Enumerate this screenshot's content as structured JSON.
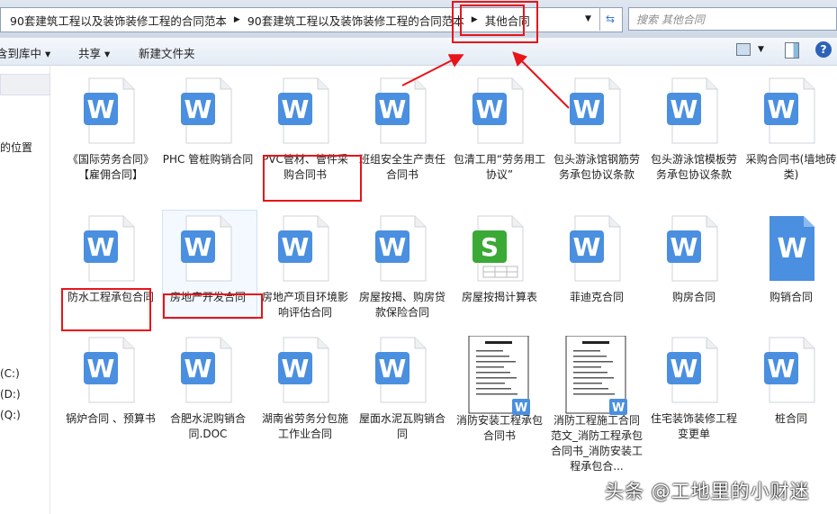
{
  "breadcrumb": [
    "90套建筑工程以及装饰装修工程的合同范本",
    "90套建筑工程以及装饰装修工程的合同范本",
    "其他合同"
  ],
  "search_placeholder": "搜索 其他合同",
  "toolbar": {
    "library": "含到库中 ▾",
    "share": "共享 ▾",
    "new_folder": "新建文件夹"
  },
  "sidebar": {
    "location": "的位置",
    "drives": [
      "(C:)",
      "(D:)",
      "(Q:)"
    ]
  },
  "files": [
    {
      "name": "《国际劳务合同》【雇佣合同】",
      "type": "doc"
    },
    {
      "name": "PHC 管桩购销合同",
      "type": "doc"
    },
    {
      "name": "PVC管材、管件采购合同书",
      "type": "doc"
    },
    {
      "name": "班组安全生产责任合同书",
      "type": "doc"
    },
    {
      "name": "包清工用“劳务用工协议”",
      "type": "doc"
    },
    {
      "name": "包头游泳馆钢筋劳务承包协议条款",
      "type": "doc"
    },
    {
      "name": "包头游泳馆模板劳务承包协议条款",
      "type": "doc"
    },
    {
      "name": "采购合同书(墙地砖类)",
      "type": "doc"
    },
    {
      "name": "防水工程承包合同",
      "type": "doc"
    },
    {
      "name": "房地产开发合同",
      "type": "doc"
    },
    {
      "name": "房地产项目环境影响评估合同",
      "type": "doc"
    },
    {
      "name": "房屋按揭、购房贷款保险合同",
      "type": "doc"
    },
    {
      "name": "房屋按揭计算表",
      "type": "sheet"
    },
    {
      "name": "菲迪克合同",
      "type": "doc"
    },
    {
      "name": "购房合同",
      "type": "doc"
    },
    {
      "name": "购销合同",
      "type": "docsolid"
    },
    {
      "name": "锅炉合同 、预算书",
      "type": "doc"
    },
    {
      "name": "合肥水泥购销合同.DOC",
      "type": "doc"
    },
    {
      "name": "湖南省劳务分包施工作业合同",
      "type": "doc"
    },
    {
      "name": "屋面水泥瓦购销合同",
      "type": "doc"
    },
    {
      "name": "消防安装工程承包合同书",
      "type": "thumb"
    },
    {
      "name": "消防工程施工合同范文_消防工程承包合同书_消防安装工程承包合...",
      "type": "thumb"
    },
    {
      "name": "住宅装饰装修工程变更单",
      "type": "doc"
    },
    {
      "name": "桩合同",
      "type": "doc"
    }
  ],
  "watermark": "头条 @工地里的小财迷",
  "colors": {
    "accent": "#4a8fe0",
    "red": "#e8141a",
    "green": "#3aa935"
  }
}
